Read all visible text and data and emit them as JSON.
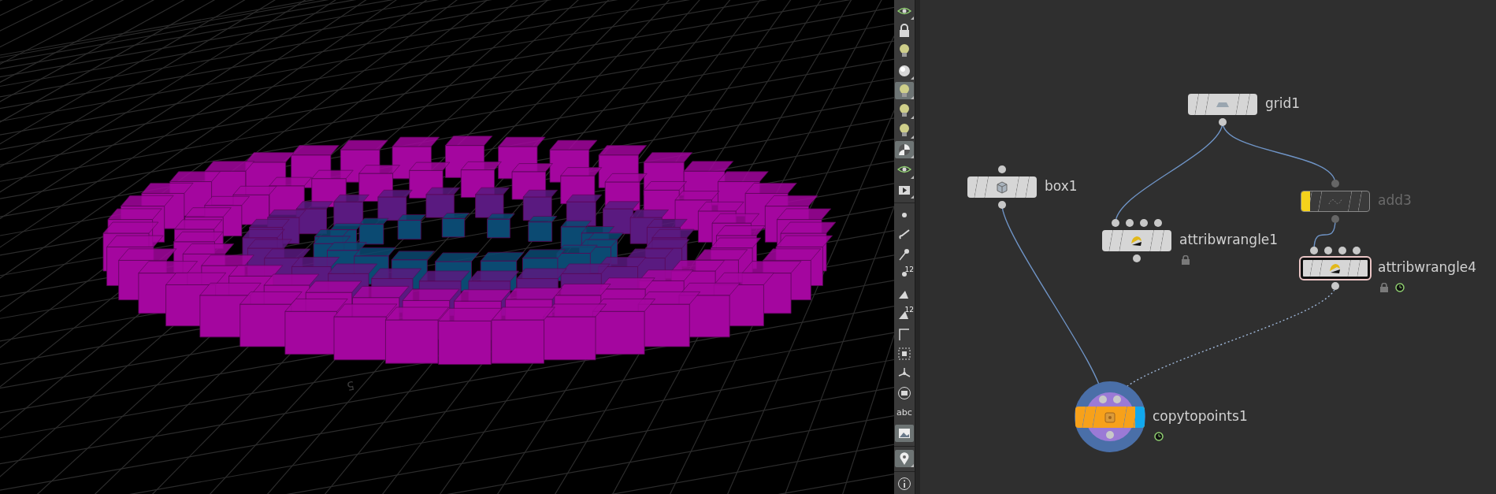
{
  "viewport": {
    "grid_label": "5"
  },
  "toolbar": {
    "items": [
      {
        "kind": "icon",
        "selected": false,
        "menu": true
      },
      {
        "kind": "icon",
        "selected": false,
        "menu": false
      },
      {
        "kind": "icon",
        "selected": false,
        "menu": false
      },
      {
        "kind": "icon",
        "selected": false,
        "menu": true
      },
      {
        "kind": "icon",
        "selected": true,
        "menu": true
      },
      {
        "kind": "icon",
        "selected": false,
        "menu": true
      },
      {
        "kind": "icon",
        "selected": false,
        "menu": true
      },
      {
        "kind": "icon",
        "selected": true,
        "menu": true
      },
      {
        "kind": "icon",
        "selected": false,
        "menu": true
      },
      {
        "kind": "icon",
        "selected": false,
        "menu": true
      },
      {
        "kind": "separator"
      },
      {
        "kind": "icon",
        "selected": false,
        "menu": false
      },
      {
        "kind": "icon",
        "selected": false,
        "menu": false
      },
      {
        "kind": "icon",
        "selected": false,
        "menu": false
      },
      {
        "kind": "icon",
        "selected": false,
        "menu": false,
        "label": "12"
      },
      {
        "kind": "icon",
        "selected": false,
        "menu": false
      },
      {
        "kind": "icon",
        "selected": false,
        "menu": false,
        "label": "12"
      },
      {
        "kind": "icon",
        "selected": false,
        "menu": false
      },
      {
        "kind": "icon",
        "selected": false,
        "menu": false
      },
      {
        "kind": "icon",
        "selected": false,
        "menu": false
      },
      {
        "kind": "icon",
        "selected": false,
        "menu": false
      },
      {
        "kind": "text",
        "selected": false,
        "menu": false,
        "label": "abc"
      },
      {
        "kind": "icon",
        "selected": true,
        "menu": false
      },
      {
        "kind": "separator"
      },
      {
        "kind": "icon",
        "selected": true,
        "menu": true
      },
      {
        "kind": "separator"
      },
      {
        "kind": "icon",
        "selected": false,
        "menu": false
      }
    ]
  },
  "network": {
    "nodes": [
      {
        "name": "grid1",
        "selected": false,
        "bypassed": false,
        "display": false,
        "current": false,
        "color": "#d6d6d6"
      },
      {
        "name": "box1",
        "selected": false,
        "bypassed": false,
        "display": false,
        "current": false,
        "color": "#d6d6d6"
      },
      {
        "name": "attribwrangle1",
        "selected": false,
        "bypassed": false,
        "display": false,
        "current": false,
        "color": "#d6d6d6",
        "badges": [
          {
            "kind": "lock"
          }
        ]
      },
      {
        "name": "add3",
        "selected": false,
        "bypassed": true,
        "display": false,
        "current": false,
        "color": "#3a3a3a"
      },
      {
        "name": "attribwrangle4",
        "selected": true,
        "bypassed": false,
        "display": false,
        "current": false,
        "color": "#d6d6d6",
        "badges": [
          {
            "kind": "lock"
          },
          {
            "kind": "clock"
          }
        ]
      },
      {
        "name": "copytopoints1",
        "selected": false,
        "bypassed": false,
        "display": true,
        "current": true,
        "color": "#f7a11a",
        "badges": [
          {
            "kind": "clock"
          }
        ]
      }
    ]
  }
}
